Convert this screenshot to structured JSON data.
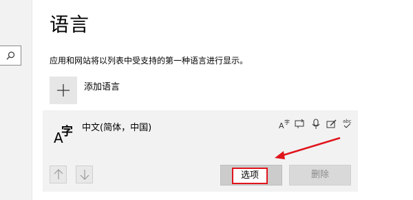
{
  "page": {
    "title": "语言",
    "description": "应用和网站将以列表中受支持的第一种语言进行显示。"
  },
  "add_language": {
    "label": "添加语言",
    "icon": "plus-icon"
  },
  "language_card": {
    "glyph_letter": "A",
    "glyph_char": "字",
    "name": "中文(简体，中国)",
    "feature_icons": [
      "display-language-icon",
      "text-to-speech-icon",
      "speech-recognition-icon",
      "handwriting-icon",
      "spell-check-icon"
    ],
    "spell_check_text": "abc"
  },
  "buttons": {
    "options": "选项",
    "remove": "删除"
  },
  "colors": {
    "highlight_box": "#e0141b",
    "annotation_arrow": "#e0141b",
    "card_bg": "#f2f2f2"
  }
}
